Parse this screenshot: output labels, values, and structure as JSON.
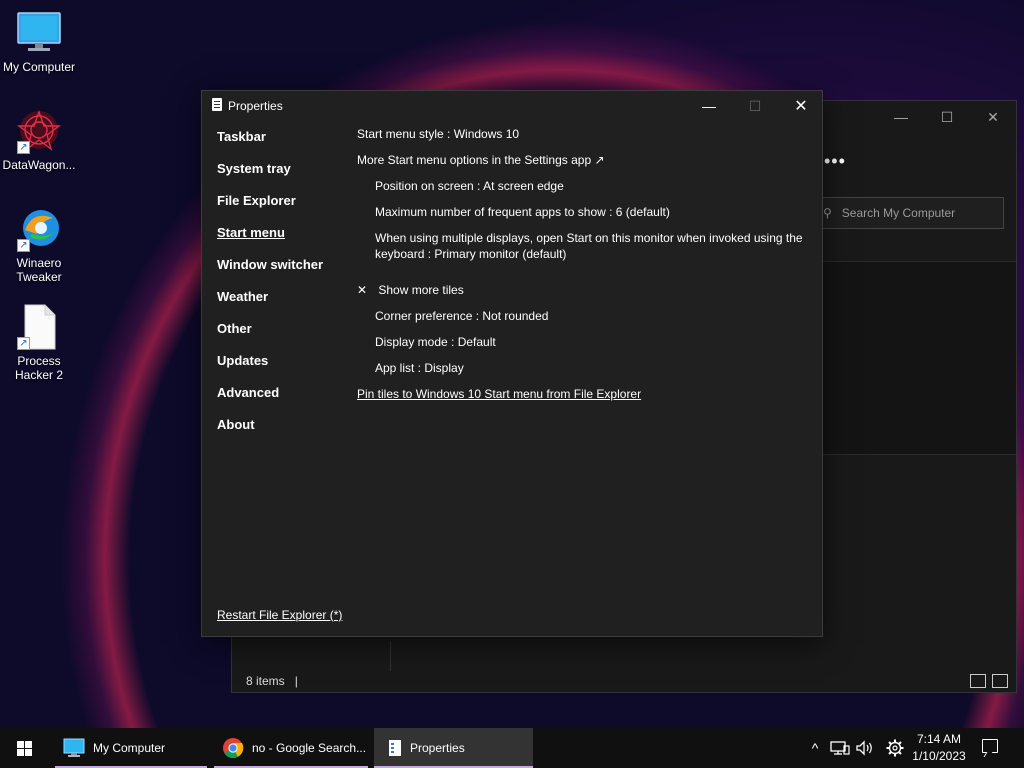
{
  "desktop": {
    "icons": [
      {
        "label": "My Computer",
        "icon": "monitor-icon"
      },
      {
        "label": "DataWagon...",
        "icon": "datawagon-icon"
      },
      {
        "label": "Winaero Tweaker",
        "icon": "winaero-icon"
      },
      {
        "label": "Process Hacker 2",
        "icon": "file-icon"
      }
    ],
    "shortcut_glyph": "↗"
  },
  "explorer": {
    "minimize": "—",
    "maximize": "☐",
    "close": "✕",
    "more": "•••",
    "search_placeholder": "Search My Computer",
    "search_glyph": "⚲",
    "status": "8 items"
  },
  "properties": {
    "title": "Properties",
    "minimize": "—",
    "maximize": "☐",
    "close": "✕",
    "nav": [
      {
        "label": "Taskbar",
        "active": false
      },
      {
        "label": "System tray",
        "active": false
      },
      {
        "label": "File Explorer",
        "active": false
      },
      {
        "label": "Start menu",
        "active": true
      },
      {
        "label": "Window switcher",
        "active": false
      },
      {
        "label": "Weather",
        "active": false
      },
      {
        "label": "Other",
        "active": false
      },
      {
        "label": "Updates",
        "active": false
      },
      {
        "label": "Advanced",
        "active": false
      },
      {
        "label": "About",
        "active": false
      }
    ],
    "restart_link": "Restart File Explorer (*)",
    "settings": {
      "start_style": "Start menu style : Windows 10",
      "more_options": "More Start menu options in the Settings app ↗",
      "position": "Position on screen : At screen edge",
      "max_frequent": "Maximum number of frequent apps to show : 6 (default)",
      "multi_display": "When using multiple displays, open Start on this monitor when invoked using the keyboard : Primary monitor (default)",
      "show_more_tiles_check": "✕",
      "show_more_tiles": "Show more tiles",
      "corner": "Corner preference : Not rounded",
      "display_mode": "Display mode : Default",
      "app_list": "App list : Display",
      "pin_tiles": "Pin tiles to Windows 10 Start menu from File Explorer"
    }
  },
  "taskbar": {
    "items": [
      {
        "label": "My Computer"
      },
      {
        "label": "no - Google Search..."
      },
      {
        "label": "Properties"
      }
    ],
    "tray_chevron": "^",
    "time": "7:14 AM",
    "date": "1/10/2023",
    "colors": {
      "accent_underline": "#c8a6e0",
      "active_bg": "#333333"
    }
  }
}
